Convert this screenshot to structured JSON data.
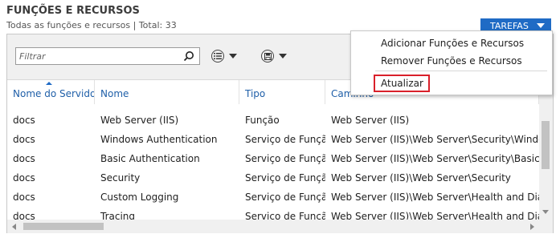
{
  "header": {
    "title": "FUNÇÕES E RECURSOS",
    "subtitle": "Todas as funções e recursos | Total: 33",
    "tasks_label": "TAREFAS"
  },
  "filter": {
    "placeholder": "Filtrar",
    "value": ""
  },
  "grid": {
    "columns": [
      "Nome do Servidor",
      "Nome",
      "Tipo",
      "Caminho"
    ],
    "rows": [
      [
        "docs",
        "Web Server (IIS)",
        "Função",
        "Web Server (IIS)"
      ],
      [
        "docs",
        "Windows Authentication",
        "Serviço de Função",
        "Web Server (IIS)\\Web Server\\Security\\Windows A"
      ],
      [
        "docs",
        "Basic Authentication",
        "Serviço de Função",
        "Web Server (IIS)\\Web Server\\Security\\Basic Authe"
      ],
      [
        "docs",
        "Security",
        "Serviço de Função",
        "Web Server (IIS)\\Web Server\\Security"
      ],
      [
        "docs",
        "Custom Logging",
        "Serviço de Função",
        "Web Server (IIS)\\Web Server\\Health and Diagnos"
      ],
      [
        "docs",
        "Tracing",
        "Serviço de Função",
        "Web Server (IIS)\\Web Server\\Health and Diagnos"
      ]
    ]
  },
  "menu": {
    "items": [
      "Adicionar Funções e Recursos",
      "Remover Funções e Recursos",
      "Atualizar"
    ]
  },
  "icons": {
    "search": "search-icon",
    "list": "list-options-icon",
    "save": "save-icon",
    "dropdown": "chevron-down-icon"
  },
  "colors": {
    "accent": "#1f6bc5",
    "highlight_border": "#d9202a"
  }
}
